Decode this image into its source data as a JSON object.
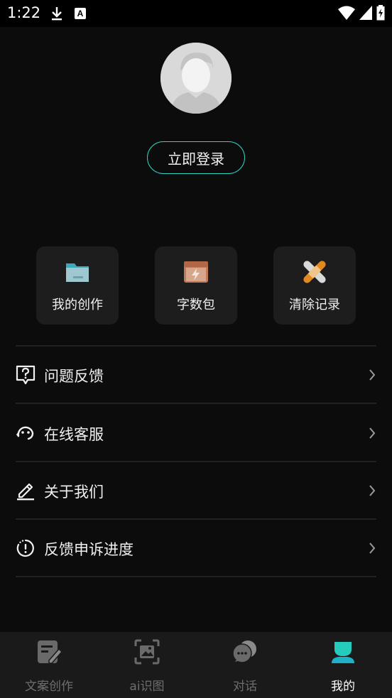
{
  "status_bar": {
    "time": "1:22",
    "badge": "A"
  },
  "login": {
    "label": "立即登录"
  },
  "quick_actions": [
    {
      "label": "我的创作",
      "icon": "folder-icon"
    },
    {
      "label": "字数包",
      "icon": "lightning-box-icon"
    },
    {
      "label": "清除记录",
      "icon": "bandage-cross-icon"
    }
  ],
  "menu": [
    {
      "label": "问题反馈",
      "icon": "question-bubble-icon"
    },
    {
      "label": "在线客服",
      "icon": "headset-icon"
    },
    {
      "label": "关于我们",
      "icon": "pencil-icon"
    },
    {
      "label": "反馈申诉进度",
      "icon": "timer-alert-icon"
    }
  ],
  "tabs": [
    {
      "label": "文案创作",
      "icon": "edit-doc-icon"
    },
    {
      "label": "ai识图",
      "icon": "scan-image-icon"
    },
    {
      "label": "对话",
      "icon": "chat-bubbles-icon"
    },
    {
      "label": "我的",
      "icon": "user-icon",
      "active": true
    }
  ],
  "colors": {
    "accent": "#2dd3c3",
    "background": "#0c0c0c",
    "tile": "#1d1d1d",
    "tabbar": "#1a1a1a"
  }
}
